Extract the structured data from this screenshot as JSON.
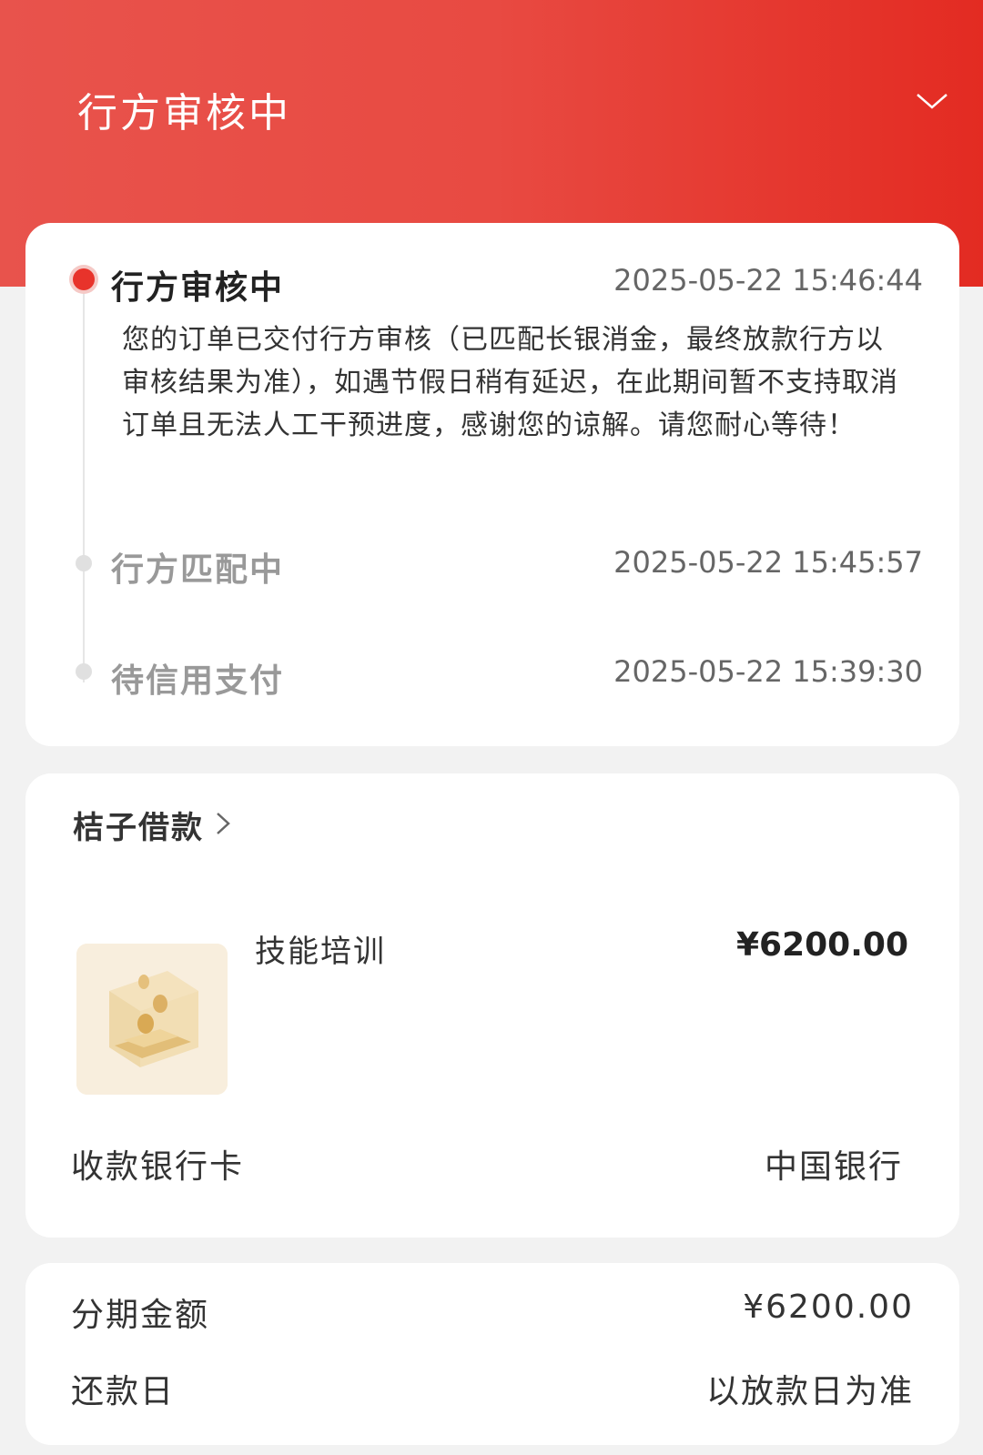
{
  "header": {
    "title": "行方审核中",
    "expand_icon": "chevron-down-icon"
  },
  "timeline": {
    "steps": [
      {
        "title": "行方审核中",
        "time": "2025-05-22 15:46:44",
        "description": "您的订单已交付行方审核（已匹配长银消金，最终放款行方以审核结果为准），如遇节假日稍有延迟，在此期间暂不支持取消订单且无法人工干预进度，感谢您的谅解。请您耐心等待！",
        "active": true
      },
      {
        "title": "行方匹配中",
        "time": "2025-05-22 15:45:57",
        "active": false
      },
      {
        "title": "待信用支付",
        "time": "2025-05-22 15:39:30",
        "active": false
      }
    ]
  },
  "order": {
    "merchant": "桔子借款",
    "product_name": "技能培训",
    "price": "¥6200.00",
    "bank_label": "收款银行卡",
    "bank_value": "中国银行"
  },
  "plan": {
    "amount_label": "分期金额",
    "amount_value": "¥6200.00",
    "repay_label": "还款日",
    "repay_value": "以放款日为准"
  },
  "colors": {
    "brand_red": "#e8332b",
    "header_gradient_start": "#e8534c",
    "header_gradient_end": "#e32b22"
  }
}
